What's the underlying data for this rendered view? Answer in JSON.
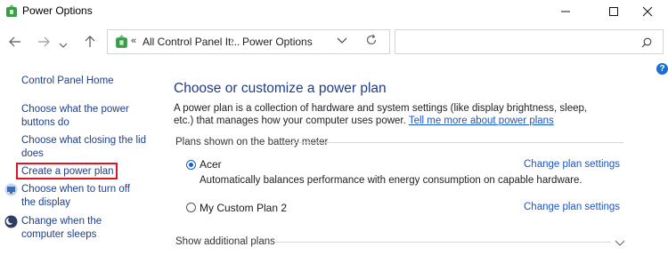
{
  "window": {
    "title": "Power Options",
    "controls": {
      "minimize": "minimize-icon",
      "maximize": "maximize-icon",
      "close": "close-icon"
    }
  },
  "nav": {
    "back_icon": "back-arrow-icon",
    "forward_icon": "forward-arrow-icon",
    "up_icon": "up-arrow-icon",
    "breadcrumb_prefix": "«",
    "crumb_root": "All Control Panel It...",
    "crumb_sep": "›",
    "crumb_current": "Power Options",
    "search_placeholder": ""
  },
  "sidebar": {
    "home": "Control Panel Home",
    "items": [
      {
        "label": "Choose what the power buttons do"
      },
      {
        "label": "Choose what closing the lid does"
      },
      {
        "label": "Create a power plan",
        "highlighted": true
      },
      {
        "label": "Choose when to turn off the display",
        "icon": "display-icon"
      },
      {
        "label": "Change when the computer sleeps",
        "icon": "moon-icon"
      }
    ]
  },
  "main": {
    "heading": "Choose or customize a power plan",
    "description": "A power plan is a collection of hardware and system settings (like display brightness, sleep, etc.) that manages how your computer uses power.",
    "description_link": "Tell me more about power plans",
    "section_label": "Plans shown on the battery meter",
    "plans": [
      {
        "name": "Acer",
        "selected": true,
        "description": "Automatically balances performance with energy consumption on capable hardware.",
        "link": "Change plan settings"
      },
      {
        "name": "My Custom Plan 2",
        "selected": false,
        "description": "",
        "link": "Change plan settings"
      }
    ],
    "show_additional": "Show additional plans"
  },
  "colors": {
    "link": "#1a57c2",
    "heading": "#1f3c88",
    "highlight": "#e0141e",
    "accent": "#1b5fc6"
  }
}
